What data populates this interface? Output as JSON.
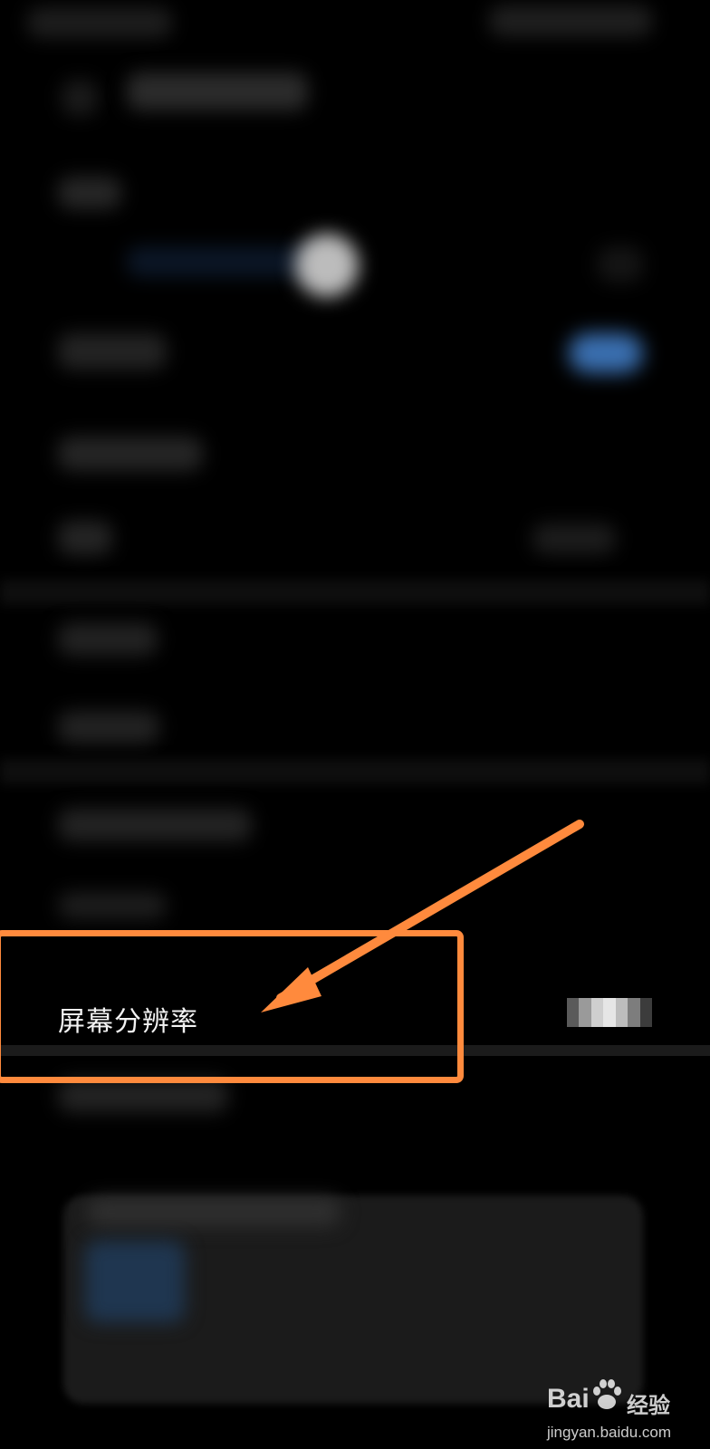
{
  "settings_screen": {
    "highlighted_item": {
      "label": "屏幕分辨率"
    }
  },
  "colors": {
    "background": "#000000",
    "annotation": "#ff8a3d",
    "label_text": "#f2f2f2",
    "toggle_accent": "#3a6fb0"
  },
  "watermark": {
    "brand": "Bai",
    "brand_cn": "经验",
    "url": "jingyan.baidu.com",
    "icon": "paw-icon"
  }
}
